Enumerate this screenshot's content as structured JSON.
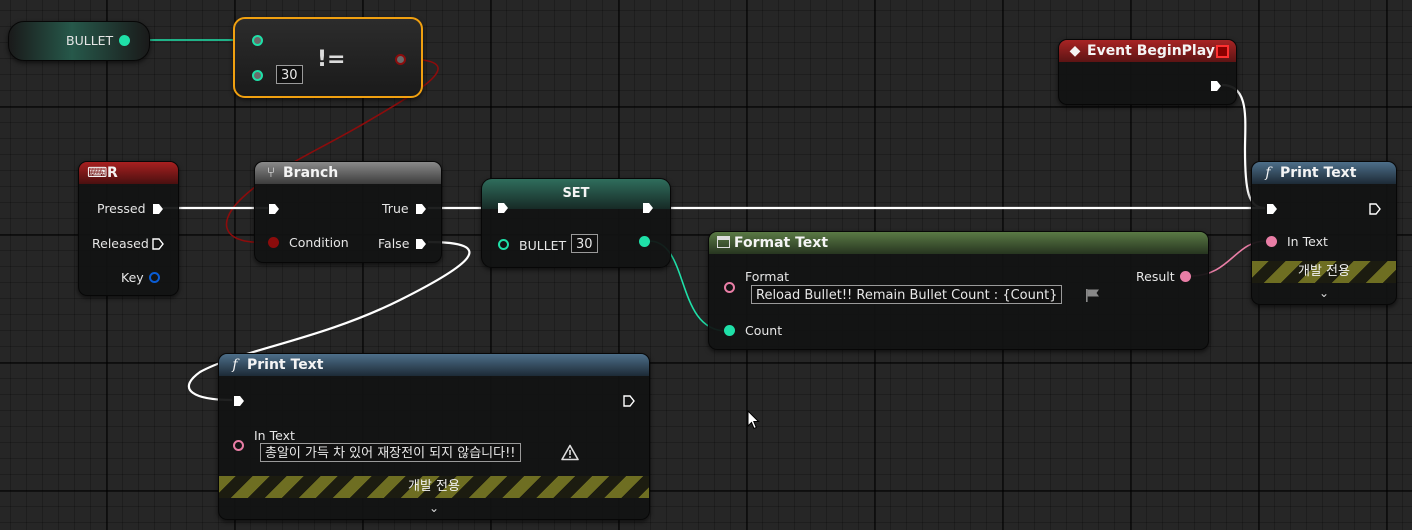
{
  "variable_get": {
    "label": "BULLET"
  },
  "not_equal": {
    "symbol": "!=",
    "b_value": "30"
  },
  "event_begin_play": {
    "title": "Event BeginPlay"
  },
  "input_r": {
    "title": "R",
    "pins": {
      "pressed": "Pressed",
      "released": "Released",
      "key": "Key"
    }
  },
  "branch": {
    "title": "Branch",
    "pins": {
      "condition": "Condition",
      "true": "True",
      "false": "False"
    }
  },
  "set_node": {
    "title": "SET",
    "var_label": "BULLET",
    "value": "30"
  },
  "format_text": {
    "title": "Format Text",
    "format_label": "Format",
    "format_value": "Reload Bullet!! Remain Bullet Count : {Count}",
    "result": "Result",
    "count": "Count"
  },
  "print_text_right": {
    "title": "Print Text",
    "in_text": "In Text",
    "dev_only": "개발 전용"
  },
  "print_text_bottom": {
    "title": "Print Text",
    "in_text": "In Text",
    "in_text_value": "총알이 가득 차 있어 재장전이 되지 않습니다!!",
    "dev_only": "개발 전용"
  },
  "icons": {
    "function": "function-f-icon",
    "event": "event-diamond-icon",
    "keyboard": "keyboard-icon",
    "branch": "branch-icon",
    "format": "format-text-icon",
    "warning": "warning-icon",
    "flag": "localization-flag-icon",
    "expand": "chevron-down-icon",
    "cursor": "mouse-cursor-icon"
  },
  "colors": {
    "exec_wire": "#ffffff",
    "int_pin": "#1fe0a8",
    "bool_pin": "#8c0c0c",
    "text_pin": "#e97ea6",
    "struct_pin": "#0a5cd4",
    "event_header": "#8e1b1b",
    "function_header": "#3e5e77",
    "variable_header": "#2b6a58",
    "format_header": "#50683f",
    "selection": "#f0a010"
  }
}
